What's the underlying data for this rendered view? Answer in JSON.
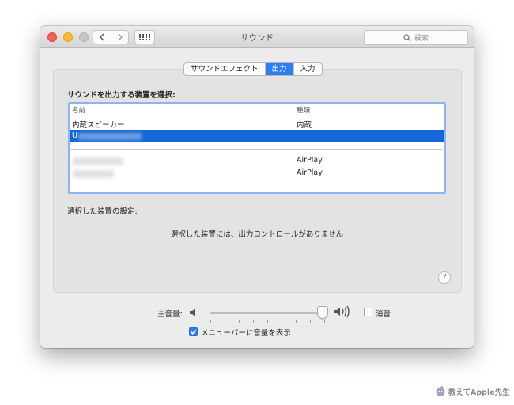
{
  "window": {
    "title": "サウンド"
  },
  "search": {
    "placeholder": "検索"
  },
  "tabs": [
    {
      "label": "サウンドエフェクト",
      "active": false
    },
    {
      "label": "出力",
      "active": true
    },
    {
      "label": "入力",
      "active": false
    }
  ],
  "output": {
    "section_title": "サウンドを出力する装置を選択:",
    "columns": {
      "name": "名前",
      "type": "種類"
    },
    "devices": [
      {
        "name": "内蔵スピーカー",
        "type": "内蔵",
        "selected": false
      },
      {
        "name": "U",
        "type": "",
        "selected": true
      },
      {
        "name": "",
        "type": "AirPlay",
        "selected": false
      },
      {
        "name": "",
        "type": "AirPlay",
        "selected": false
      }
    ]
  },
  "device_settings": {
    "label": "選択した装置の設定:",
    "message": "選択した装置には、出力コントロールがありません"
  },
  "help": {
    "label": "?"
  },
  "volume": {
    "label": "主音量:",
    "level": 0.95,
    "mute_label": "消音",
    "mute_checked": false
  },
  "menubar": {
    "label": "メニューバーに音量を表示",
    "checked": true
  },
  "watermark": {
    "text": "教えてApple先生"
  },
  "colors": {
    "accent": "#2b7ff0",
    "selection": "#1467d8",
    "close": "#fc5f57",
    "minimize": "#fdbc2e"
  }
}
